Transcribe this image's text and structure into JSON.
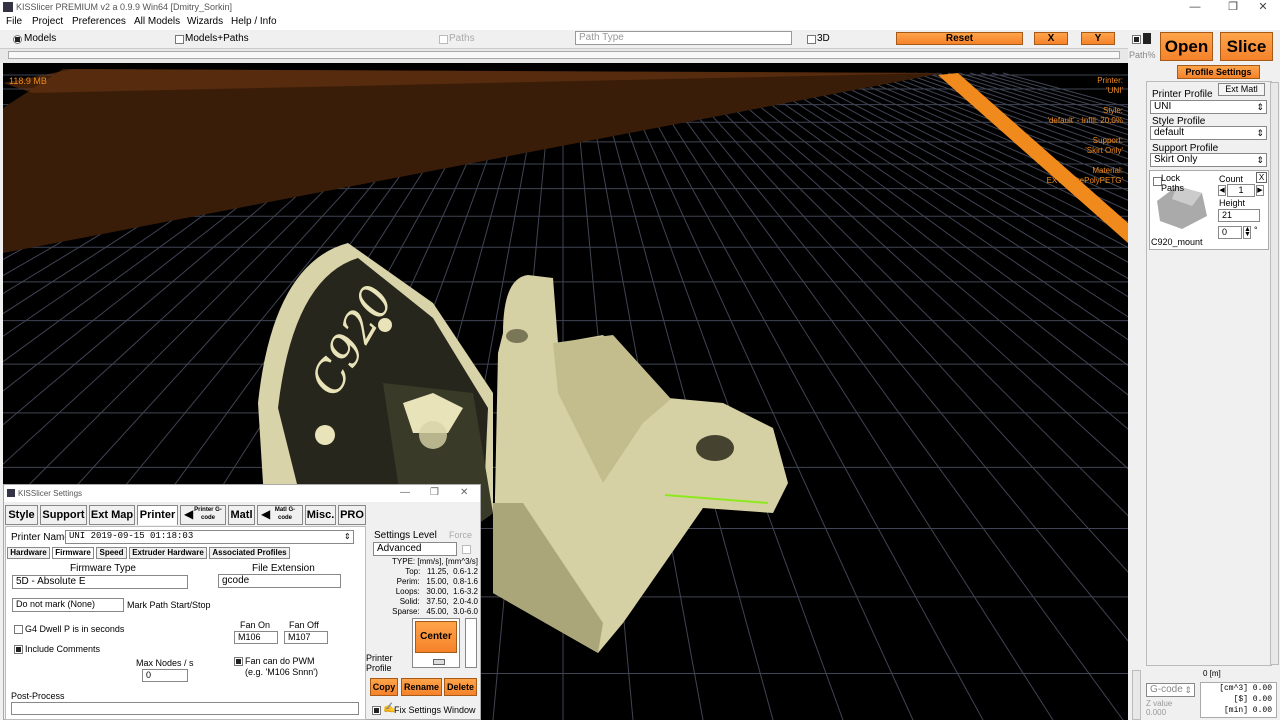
{
  "window": {
    "title": "KISSlicer PREMIUM v2 a 0.9.9 Win64 [Dmitry_Sorkin]",
    "minimize": "—",
    "maximize": "❐",
    "close": "✕"
  },
  "menu": [
    "File",
    "Project",
    "Preferences",
    "All Models",
    "Wizards",
    "Help / Info"
  ],
  "toolbar": {
    "models": "Models",
    "models_paths": "Models+Paths",
    "paths": "Paths",
    "path_type": "Path Type",
    "three_d": "3D",
    "reset": "Reset",
    "x": "X",
    "y": "Y",
    "path_pct": "Path%"
  },
  "viewport": {
    "memory": "118.9 MB",
    "printer_label": "Printer:",
    "printer_value": "'UNI'",
    "style_label": "Style:",
    "style_value": "'default' - Infill: 20.0%",
    "support_label": "Support:",
    "support_value": "'Skirt Only'",
    "material_label": "Material:",
    "material_value": "EXT1 'ThePolyPETG'",
    "model_text": "C920"
  },
  "right_panel": {
    "open": "Open",
    "slice": "Slice",
    "profile_settings": "Profile Settings",
    "printer_profile_label": "Printer Profile",
    "ext_matl": "Ext Matl",
    "printer_profile": "UNI",
    "style_profile_label": "Style Profile",
    "style_profile": "default",
    "support_profile_label": "Support Profile",
    "support_profile": "Skirt Only",
    "lock_paths": "Lock Paths",
    "count_label": "Count",
    "count": "1",
    "height_label": "Height",
    "height": "21",
    "rotation": "0",
    "degree": "°",
    "model_name": "C920_mount",
    "close_x": "X",
    "ruler": "0 [m]",
    "gcode": "G-code",
    "z_value_label": "Z value",
    "z_value": "0.000",
    "stats": [
      "[cm^3] 0.00",
      "[$] 0.00",
      "[min] 0.00"
    ]
  },
  "settings": {
    "title": "KISSlicer Settings",
    "tabs": [
      "Style",
      "Support",
      "Ext Map",
      "Printer",
      "Printer G-code",
      "Matl",
      "Matl G-code",
      "Misc.",
      "PRO"
    ],
    "printer_name_label": "Printer Name",
    "printer_name": "UNI  2019-09-15 01:18:03",
    "subtabs": [
      "Hardware",
      "Firmware",
      "Speed",
      "Extruder Hardware",
      "Associated Profiles"
    ],
    "firmware_type_label": "Firmware Type",
    "firmware_type": "5D - Absolute E",
    "file_ext_label": "File Extension",
    "file_ext": "gcode",
    "mark_path_select": "Do not mark (None)",
    "mark_path_label": "Mark Path Start/Stop",
    "g4_dwell": "G4 Dwell P is in seconds",
    "include_comments": "Include Comments",
    "fan_on_label": "Fan On",
    "fan_on": "M106",
    "fan_off_label": "Fan Off",
    "fan_off": "M107",
    "max_nodes_label": "Max Nodes / s",
    "max_nodes": "0",
    "fan_pwm_line1": "Fan can do PWM",
    "fan_pwm_line2": "(e.g. 'M106 Snnn')",
    "post_process_label": "Post-Process",
    "settings_level_label": "Settings Level",
    "force_label": "Force",
    "settings_level": "Advanced",
    "speed_table": [
      "TYPE: [mm/s], [mm^3/s]",
      "Top:   11.25,  0.6-1.2",
      "Perim:   15.00,  0.8-1.6",
      "Loops:   30.00,  1.6-3.2",
      "Solid:   37.50,  2.0-4.0",
      "Sparse:   45.00,  3.0-6.0"
    ],
    "center": "Center",
    "printer_profile_label": "Printer Profile",
    "copy": "Copy",
    "rename": "Rename",
    "delete": "Delete",
    "fix_window": "Fix Settings Window"
  }
}
